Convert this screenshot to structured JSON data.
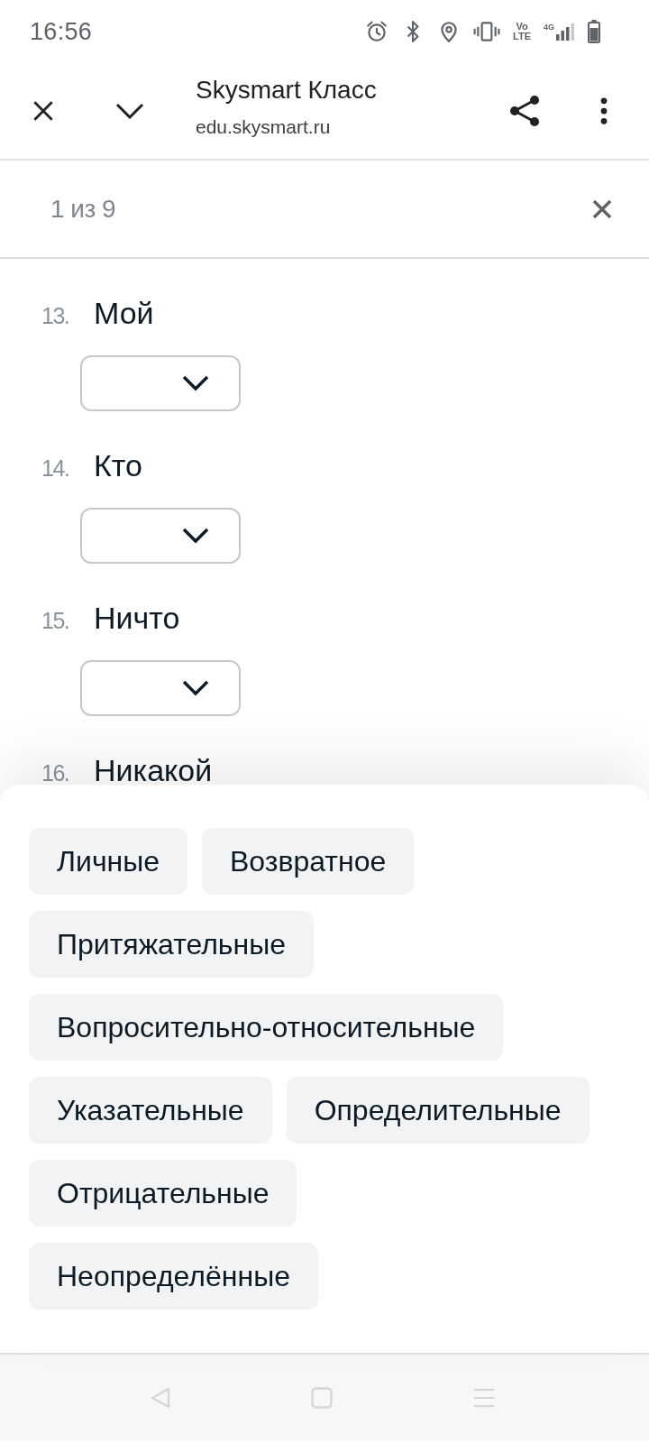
{
  "status_bar": {
    "time": "16:56",
    "volte": [
      "Vo",
      "LTE"
    ],
    "network": "4G"
  },
  "browser_bar": {
    "title": "Skysmart Класс",
    "url": "edu.skysmart.ru"
  },
  "find_bar": {
    "match_count": "1 из 9"
  },
  "questions": [
    {
      "number": "13.",
      "word": "Мой",
      "dropdown": {
        "expanded": false
      }
    },
    {
      "number": "14.",
      "word": "Кто",
      "dropdown": {
        "expanded": false
      }
    },
    {
      "number": "15.",
      "word": "Ничто",
      "dropdown": {
        "expanded": false
      }
    },
    {
      "number": "16.",
      "word": "Никакой"
    }
  ],
  "answer_sheet": {
    "options": [
      "Личные",
      "Возвратное",
      "Притяжательные",
      "Вопросительно-относительные",
      "Указательные",
      "Определительные",
      "Отрицательные",
      "Неопределённые"
    ]
  }
}
